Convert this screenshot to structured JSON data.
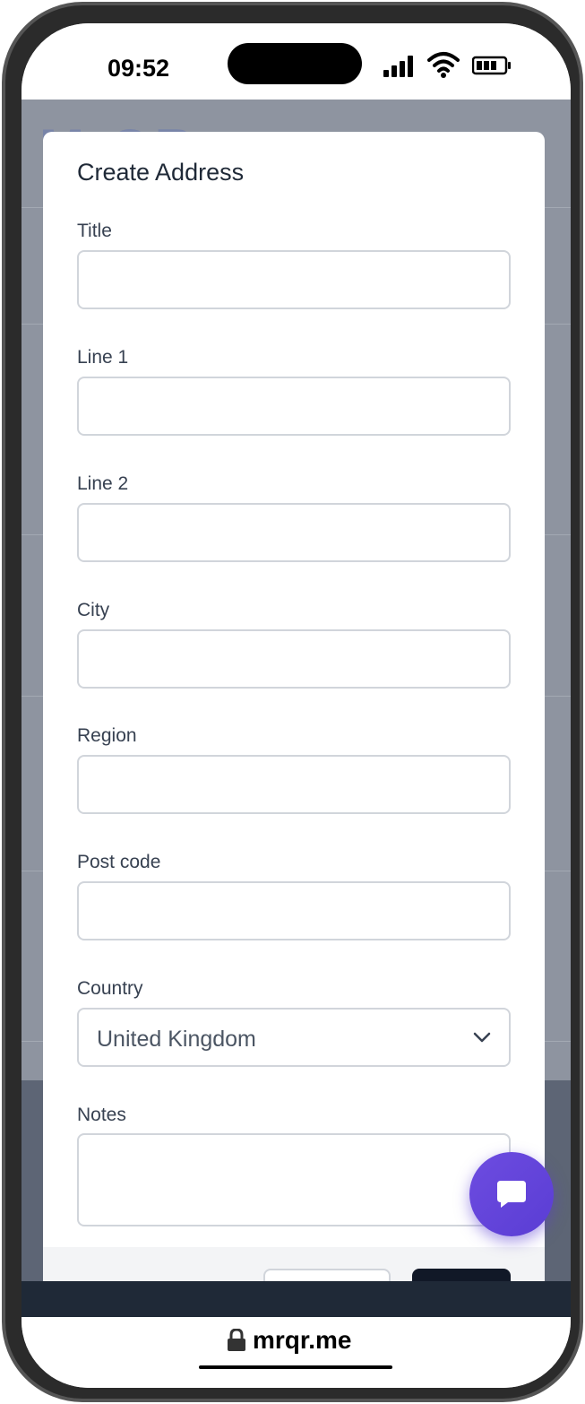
{
  "status_bar": {
    "time": "09:52",
    "icons": [
      "signal-icon",
      "wifi-icon",
      "battery-icon"
    ]
  },
  "background": {
    "logo_text": "M-QR"
  },
  "modal": {
    "title": "Create Address",
    "fields": {
      "title": {
        "label": "Title",
        "value": ""
      },
      "line1": {
        "label": "Line 1",
        "value": ""
      },
      "line2": {
        "label": "Line 2",
        "value": ""
      },
      "city": {
        "label": "City",
        "value": ""
      },
      "region": {
        "label": "Region",
        "value": ""
      },
      "postcode": {
        "label": "Post code",
        "value": ""
      },
      "country": {
        "label": "Country",
        "value": "United Kingdom"
      },
      "notes": {
        "label": "Notes",
        "value": ""
      }
    }
  },
  "chat_button": {
    "icon": "chat-bubble-icon"
  },
  "browser": {
    "url": "mrqr.me",
    "lock_icon": "lock-icon"
  },
  "colors": {
    "overlay": "#8e94a0",
    "accent": "#5a3dd4",
    "dark": "#1f2937"
  }
}
